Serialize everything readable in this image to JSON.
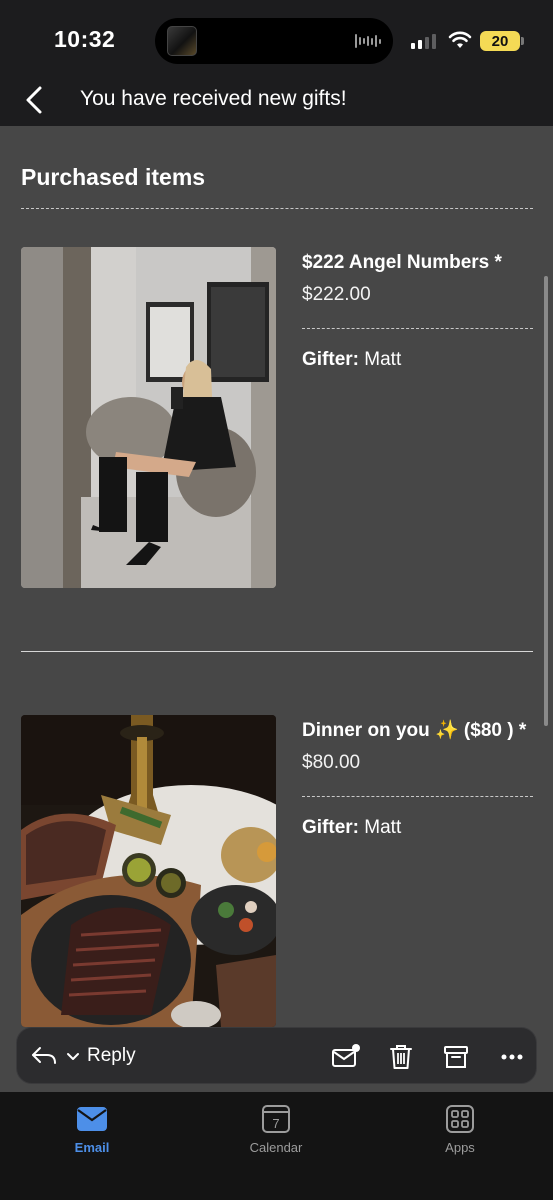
{
  "status_bar": {
    "time": "10:32",
    "battery": "20"
  },
  "header": {
    "title": "You have received new gifts!"
  },
  "section": {
    "title": "Purchased items"
  },
  "items": [
    {
      "name": "$222 Angel Numbers *",
      "price": "$222.00",
      "gifter_label": "Gifter:",
      "gifter": "Matt",
      "image": "mirror-selfie-photo"
    },
    {
      "name": "Dinner on you ✨ ($80 ) *",
      "price": "$80.00",
      "gifter_label": "Gifter:",
      "gifter": "Matt",
      "image": "steak-dinner-photo"
    }
  ],
  "actions": {
    "reply_label": "Reply"
  },
  "tabs": [
    {
      "label": "Email",
      "icon": "envelope-icon",
      "active": true
    },
    {
      "label": "Calendar",
      "icon": "calendar-icon",
      "date": "7",
      "active": false
    },
    {
      "label": "Apps",
      "icon": "apps-grid-icon",
      "active": false
    }
  ],
  "colors": {
    "accent": "#4d8fe8",
    "battery": "#f4da55",
    "content_bg": "#474747"
  }
}
